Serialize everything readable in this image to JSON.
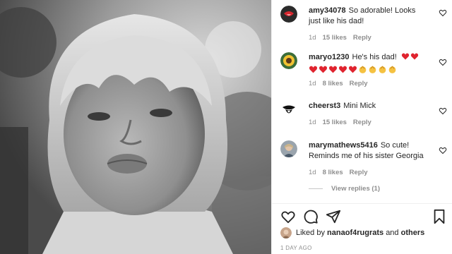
{
  "comments": [
    {
      "username": "amy34078",
      "text": "So adorable! Looks just like his dad!",
      "time": "1d",
      "likes": "15 likes",
      "reply": "Reply",
      "avatar": "rolling-stones-lips-avatar"
    },
    {
      "username": "maryo1230",
      "text": "He's his dad!",
      "emoji_tail": [
        "red-heart",
        "red-heart"
      ],
      "emoji_line": [
        "red-heart",
        "red-heart",
        "red-heart",
        "red-heart",
        "red-heart",
        "clapping-hands",
        "clapping-hands",
        "clapping-hands",
        "clapping-hands"
      ],
      "time": "1d",
      "likes": "8 likes",
      "reply": "Reply",
      "avatar": "sunflower-avatar"
    },
    {
      "username": "cheerst3",
      "text": "Mini Mick",
      "time": "1d",
      "likes": "15 likes",
      "reply": "Reply",
      "avatar": "tongue-logo-avatar"
    },
    {
      "username": "marymathews5416",
      "text": "So cute! Reminds me of his sister Georgia",
      "time": "1d",
      "likes": "8 likes",
      "reply": "Reply",
      "avatar": "woman-photo-avatar"
    }
  ],
  "view_replies": "View replies (1)",
  "actions": [
    "heart-icon",
    "comment-icon",
    "share-icon",
    "bookmark-icon"
  ],
  "liked_by": {
    "prefix": "Liked by",
    "user": "nanaof4rugrats",
    "conjunction": "and",
    "others": "others"
  },
  "timestamp": "1 DAY AGO",
  "colors": {
    "text": "#262626",
    "muted": "#8e8e8e",
    "heart_red": "#ed4956",
    "divider": "#efefef"
  }
}
